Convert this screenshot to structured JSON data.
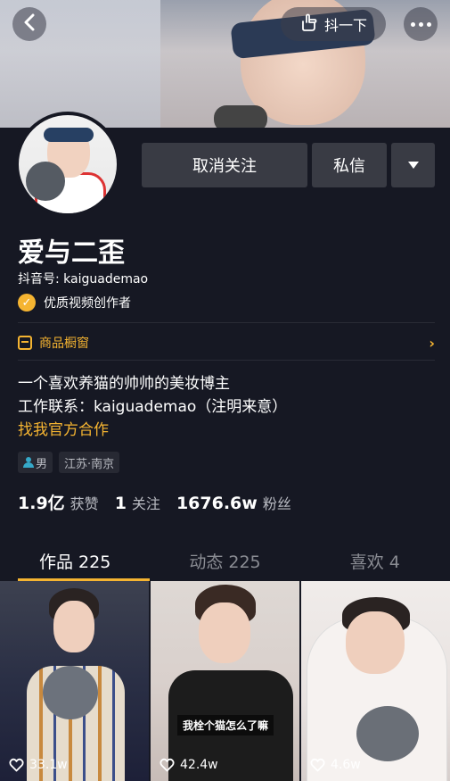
{
  "header": {
    "shake_label": "抖一下"
  },
  "actions": {
    "unfollow_label": "取消关注",
    "message_label": "私信"
  },
  "profile": {
    "name": "爱与二歪",
    "douyin_id": "抖音号: kaiguademao",
    "creator_badge": "优质视频创作者"
  },
  "shop": {
    "label": "商品橱窗",
    "chevron": "›"
  },
  "bio": {
    "line1": "一个喜欢养猫的帅帅的美妆博主",
    "line2": "工作联系：kaiguademao（注明来意）",
    "link": "找我官方合作"
  },
  "tags": {
    "gender": "男",
    "location": "江苏·南京"
  },
  "stats": {
    "likes_num": "1.9亿",
    "likes_label": "获赞",
    "following_num": "1",
    "following_label": "关注",
    "followers_num": "1676.6w",
    "followers_label": "粉丝"
  },
  "tabs": [
    {
      "label": "作品 225",
      "active": true
    },
    {
      "label": "动态 225",
      "active": false
    },
    {
      "label": "喜欢 4",
      "active": false
    }
  ],
  "videos": [
    {
      "likes": "33.1w",
      "caption": ""
    },
    {
      "likes": "42.4w",
      "caption": "我栓个猫怎么了嘛"
    },
    {
      "likes": "4.6w",
      "caption": ""
    }
  ],
  "colors": {
    "background": "#161823",
    "accent": "#f5b431",
    "button": "#393b44"
  },
  "icons": [
    "back-icon",
    "shake-hand-icon",
    "more-icon",
    "dropdown-icon",
    "verified-check-icon",
    "shop-icon",
    "chevron-right-icon",
    "gender-male-icon",
    "heart-icon"
  ]
}
